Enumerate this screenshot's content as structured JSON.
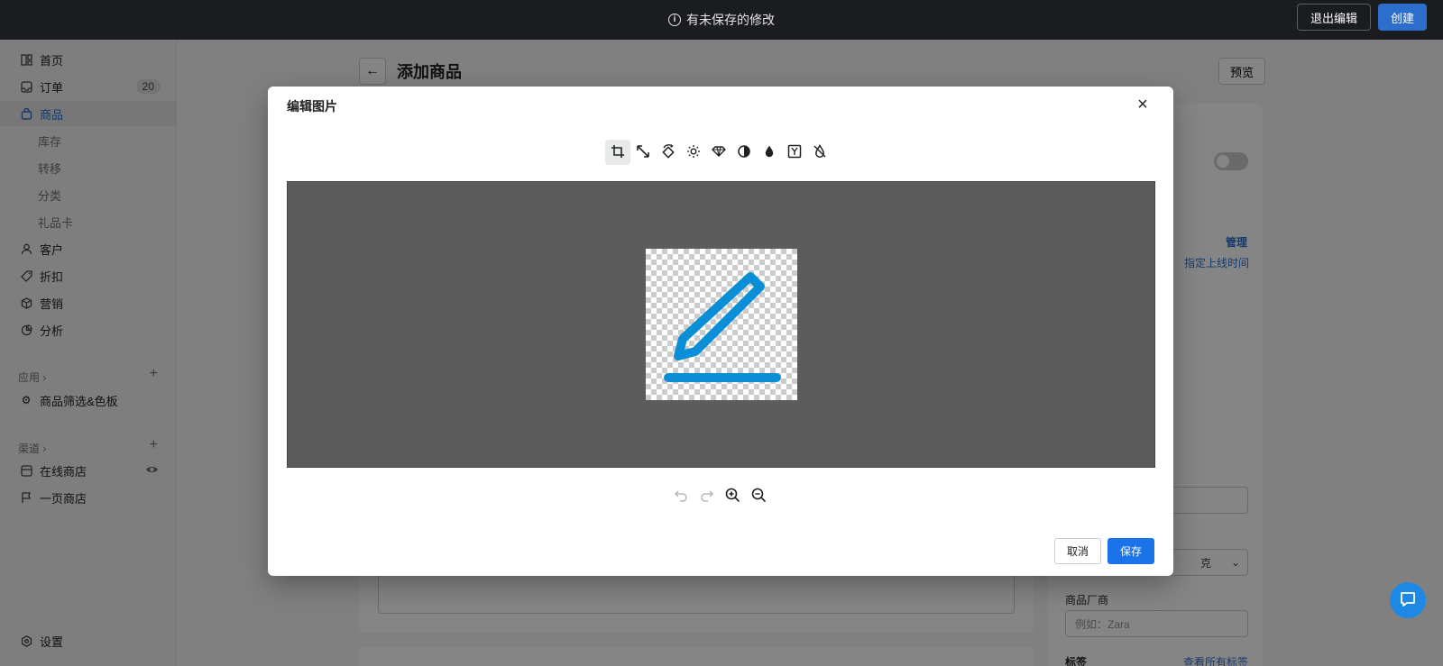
{
  "topbar": {
    "unsaved_text": "有未保存的修改",
    "exit_label": "退出编辑",
    "create_label": "创建"
  },
  "sidebar": {
    "items": [
      {
        "label": "首页",
        "icon": "home-icon"
      },
      {
        "label": "订单",
        "icon": "orders-icon",
        "badge": "20"
      },
      {
        "label": "商品",
        "icon": "bag-icon",
        "active": true
      },
      {
        "label": "库存"
      },
      {
        "label": "转移"
      },
      {
        "label": "分类"
      },
      {
        "label": "礼品卡"
      },
      {
        "label": "客户",
        "icon": "person-icon"
      },
      {
        "label": "折扣",
        "icon": "tag-icon"
      },
      {
        "label": "营销",
        "icon": "box-icon"
      },
      {
        "label": "分析",
        "icon": "chart-icon"
      }
    ],
    "apps_label": "应用",
    "apps_item": "商品筛选&色板",
    "channels_label": "渠道",
    "channel_items": [
      {
        "label": "在线商店"
      },
      {
        "label": "一页商店"
      }
    ],
    "settings_label": "设置"
  },
  "main": {
    "page_title": "添加商品",
    "preview_label": "预览",
    "manage_link": "管理",
    "schedule_link": "指定上线时间",
    "weight_unit": "克",
    "vendor_label": "商品厂商",
    "vendor_placeholder": "例如：Zara",
    "tags_label": "标签",
    "view_tags_link": "查看所有标签"
  },
  "modal": {
    "title": "编辑图片",
    "tools": [
      "crop-icon",
      "resize-icon",
      "rotate-icon",
      "brightness-icon",
      "diamond-icon",
      "contrast-icon",
      "drop-icon",
      "filter-icon",
      "saturation-icon"
    ],
    "cancel_label": "取消",
    "save_label": "保存"
  },
  "colors": {
    "accent": "#2c6ecb",
    "pencil": "#0a8fd6"
  }
}
